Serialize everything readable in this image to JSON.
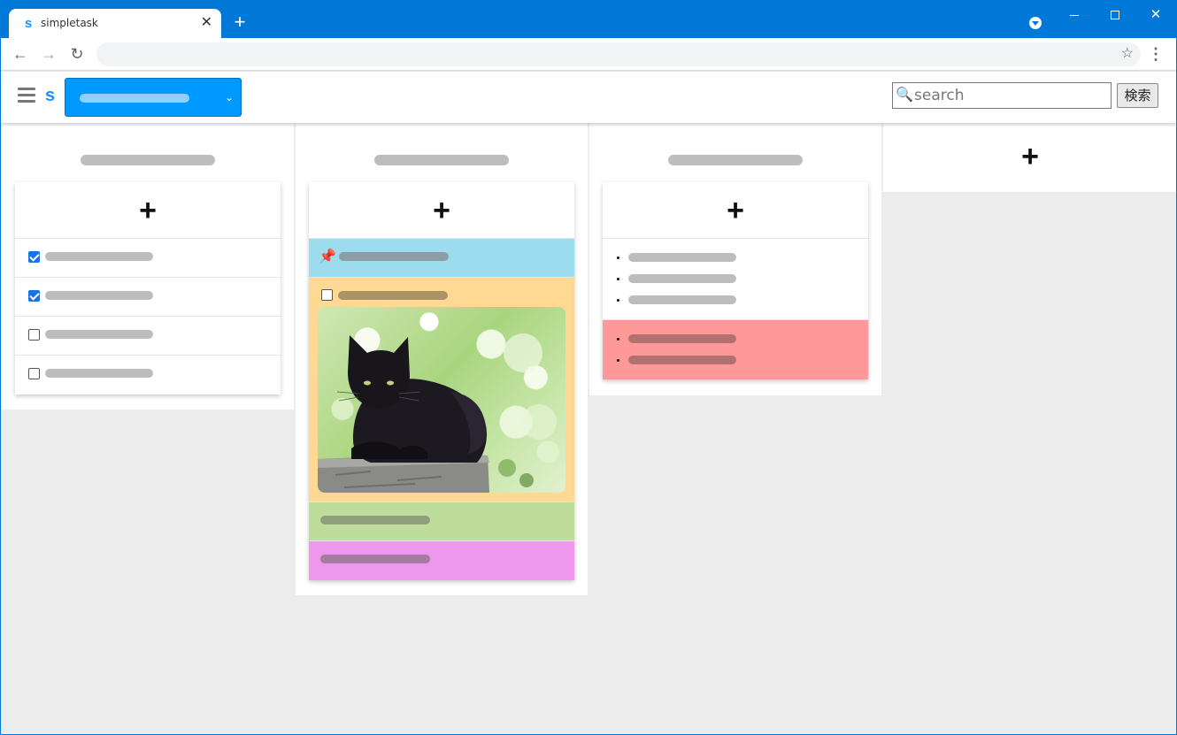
{
  "browser": {
    "tab_title": "simpletask",
    "tab_favicon": "s",
    "address": ""
  },
  "app": {
    "logo_letter": "s",
    "search_placeholder": "search",
    "search_value": "",
    "search_button": "検索"
  },
  "board": {
    "add_column_symbol": "+",
    "columns": [
      {
        "title": "",
        "card_type": "checklist",
        "items": [
          {
            "checked": true
          },
          {
            "checked": true
          },
          {
            "checked": false
          },
          {
            "checked": false
          }
        ]
      },
      {
        "title": "",
        "cards": [
          {
            "type": "pinned-note",
            "color": "#9ddcee"
          },
          {
            "type": "checkbox-image",
            "color": "#ffd994",
            "checked": false,
            "image": "black-cat-photo"
          },
          {
            "type": "note",
            "color": "#bedd9a"
          },
          {
            "type": "note",
            "color": "#ee98ed"
          }
        ]
      },
      {
        "title": "",
        "cards": [
          {
            "type": "bullet-list",
            "color": "#ffffff",
            "bullets": 3
          },
          {
            "type": "bullet-list",
            "color": "#ff9999",
            "bullets": 2
          }
        ]
      }
    ]
  },
  "colors": {
    "titlebar": "#0078d7",
    "accent": "#0099ff",
    "placeholder_bar": "#bdbdbd",
    "board_background": "#ececec"
  }
}
